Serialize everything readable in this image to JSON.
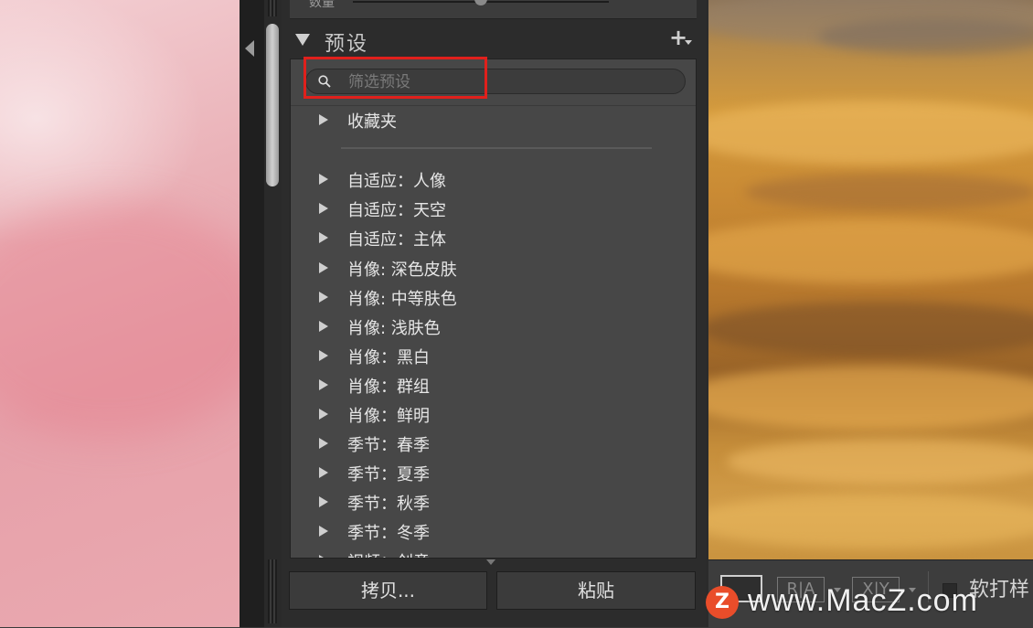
{
  "previous_panel": {
    "slider_label": "数量"
  },
  "presets_panel": {
    "title": "预设",
    "add_icon": "plus-icon",
    "search": {
      "placeholder": "筛选预设",
      "value": "",
      "icon": "search-icon"
    },
    "favorites_label": "收藏夹",
    "items": [
      "自适应：人像",
      "自适应：天空",
      "自适应：主体",
      "肖像: 深色皮肤",
      "肖像: 中等肤色",
      "肖像: 浅肤色",
      "肖像：黑白",
      "肖像：群组",
      "肖像：鲜明",
      "季节：春季",
      "季节：夏季",
      "季节：秋季",
      "季节：冬季",
      "视频：创意"
    ]
  },
  "buttons": {
    "copy": "拷贝...",
    "paste": "粘贴"
  },
  "toolbar": {
    "ref_label": "R|A",
    "compare_label": "X|Y",
    "soft_proof": "软打样"
  },
  "watermark": {
    "logo": "Z",
    "text": "www.MacZ.com"
  },
  "colors": {
    "highlight": "#e0201c",
    "panel_bg": "#474747",
    "logo": "#e94d2a"
  }
}
